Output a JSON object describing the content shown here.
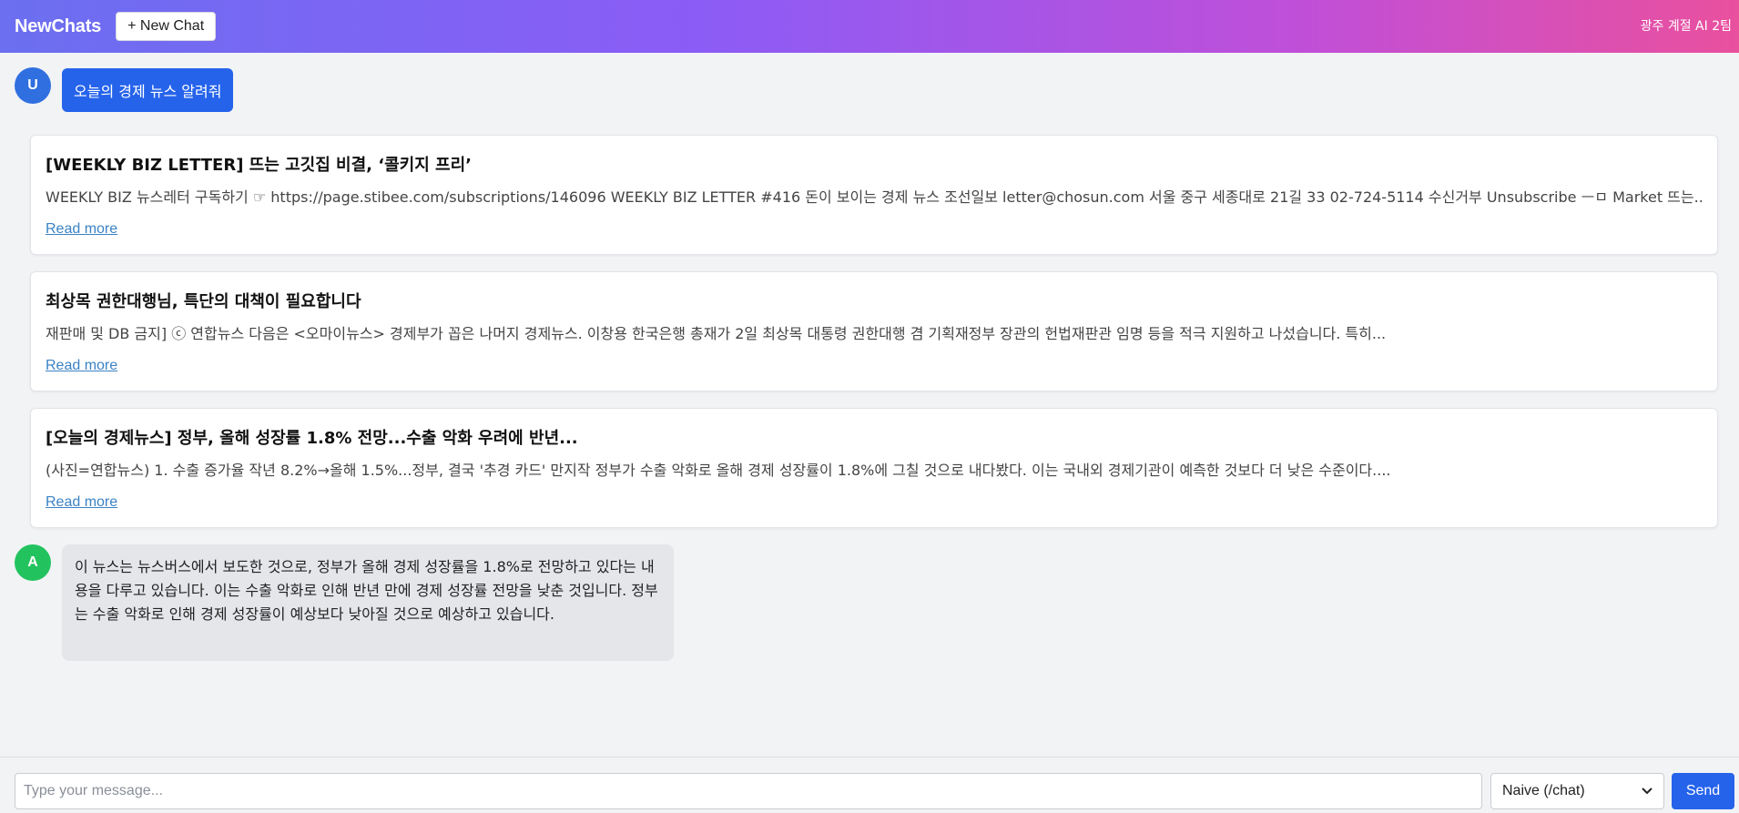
{
  "header": {
    "brand": "NewChats",
    "new_chat_label": "+ New Chat",
    "team": "광주 계절 AI 2팀"
  },
  "messages": {
    "user_avatar": "U",
    "user_text": "오늘의 경제 뉴스 알려줘",
    "assistant_avatar": "A",
    "assistant_text": "이 뉴스는 뉴스버스에서 보도한 것으로, 정부가 올해 경제 성장률을 1.8%로 전망하고 있다는 내용을 다루고 있습니다. 이는 수출 악화로 인해 반년 만에 경제 성장률 전망을 낮춘 것입니다. 정부는 수출 악화로 인해 경제 성장률이 예상보다 낮아질 것으로 예상하고 있습니다."
  },
  "cards": [
    {
      "title": "[WEEKLY BIZ LETTER] 뜨는 고깃집 비결, ‘콜키지 프리’",
      "snippet": "WEEKLY BIZ 뉴스레터 구독하기 ☞ https://page.stibee.com/subscriptions/146096 WEEKLY BIZ LETTER #416 돈이 보이는 경제 뉴스 조선일보 letter@chosun.com 서울 중구 세종대로 21길 33 02-724-5114 수신거부 Unsubscribe ㅡㅁ Market 뜨는...",
      "link": "Read more"
    },
    {
      "title": "최상목 권한대행님, 특단의 대책이 필요합니다",
      "snippet": "재판매 및 DB 금지] ⓒ 연합뉴스 다음은 <오마이뉴스> 경제부가 꼽은 나머지 경제뉴스. 이창용 한국은행 총재가 2일 최상목 대통령 권한대행 겸 기획재정부 장관의 헌법재판관 임명 등을 적극 지원하고 나섰습니다. 특히...",
      "link": "Read more"
    },
    {
      "title": "[오늘의 경제뉴스] 정부, 올해 성장률 1.8% 전망...수출 악화 우려에 반년...",
      "snippet": "(사진=연합뉴스) 1. 수출 증가율 작년 8.2%→올해 1.5%...정부, 결국 '추경 카드' 만지작 정부가 수출 악화로 올해 경제 성장률이 1.8%에 그칠 것으로 내다봤다. 이는 국내외 경제기관이 예측한 것보다 더 낮은 수준이다....",
      "link": "Read more"
    }
  ],
  "input": {
    "placeholder": "Type your message...",
    "mode": "Naive (/chat)",
    "send_label": "Send"
  }
}
